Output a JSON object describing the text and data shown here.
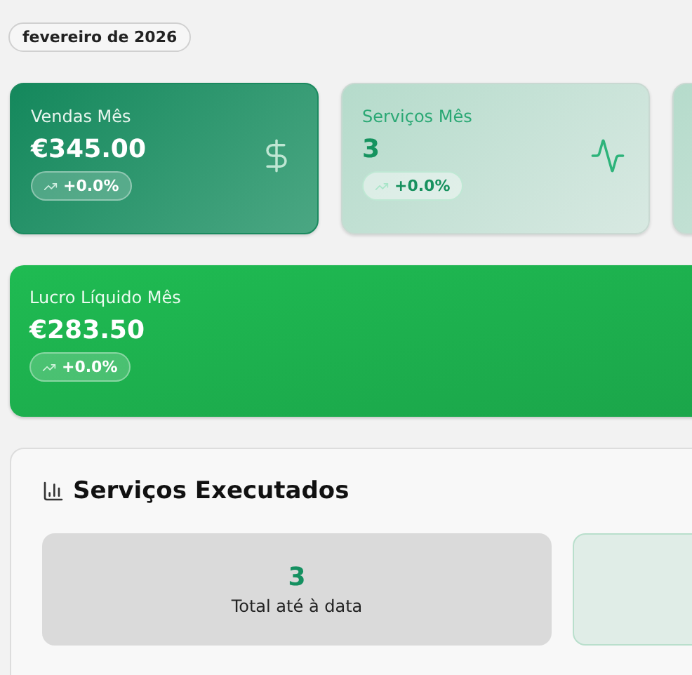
{
  "period": "fevereiro de 2026",
  "cards": [
    {
      "label": "Vendas Mês",
      "value": "€345.00",
      "change": "+0.0%",
      "kind": "solid"
    },
    {
      "label": "Serviços Mês",
      "value": "3",
      "change": "+0.0%",
      "kind": "light"
    }
  ],
  "profit_card": {
    "label": "Lucro Líquido Mês",
    "value": "€283.50",
    "change": "+0.0%"
  },
  "section": {
    "title": "Serviços Executados",
    "tiles": [
      {
        "value": "3",
        "caption": "Total até à data"
      }
    ]
  }
}
